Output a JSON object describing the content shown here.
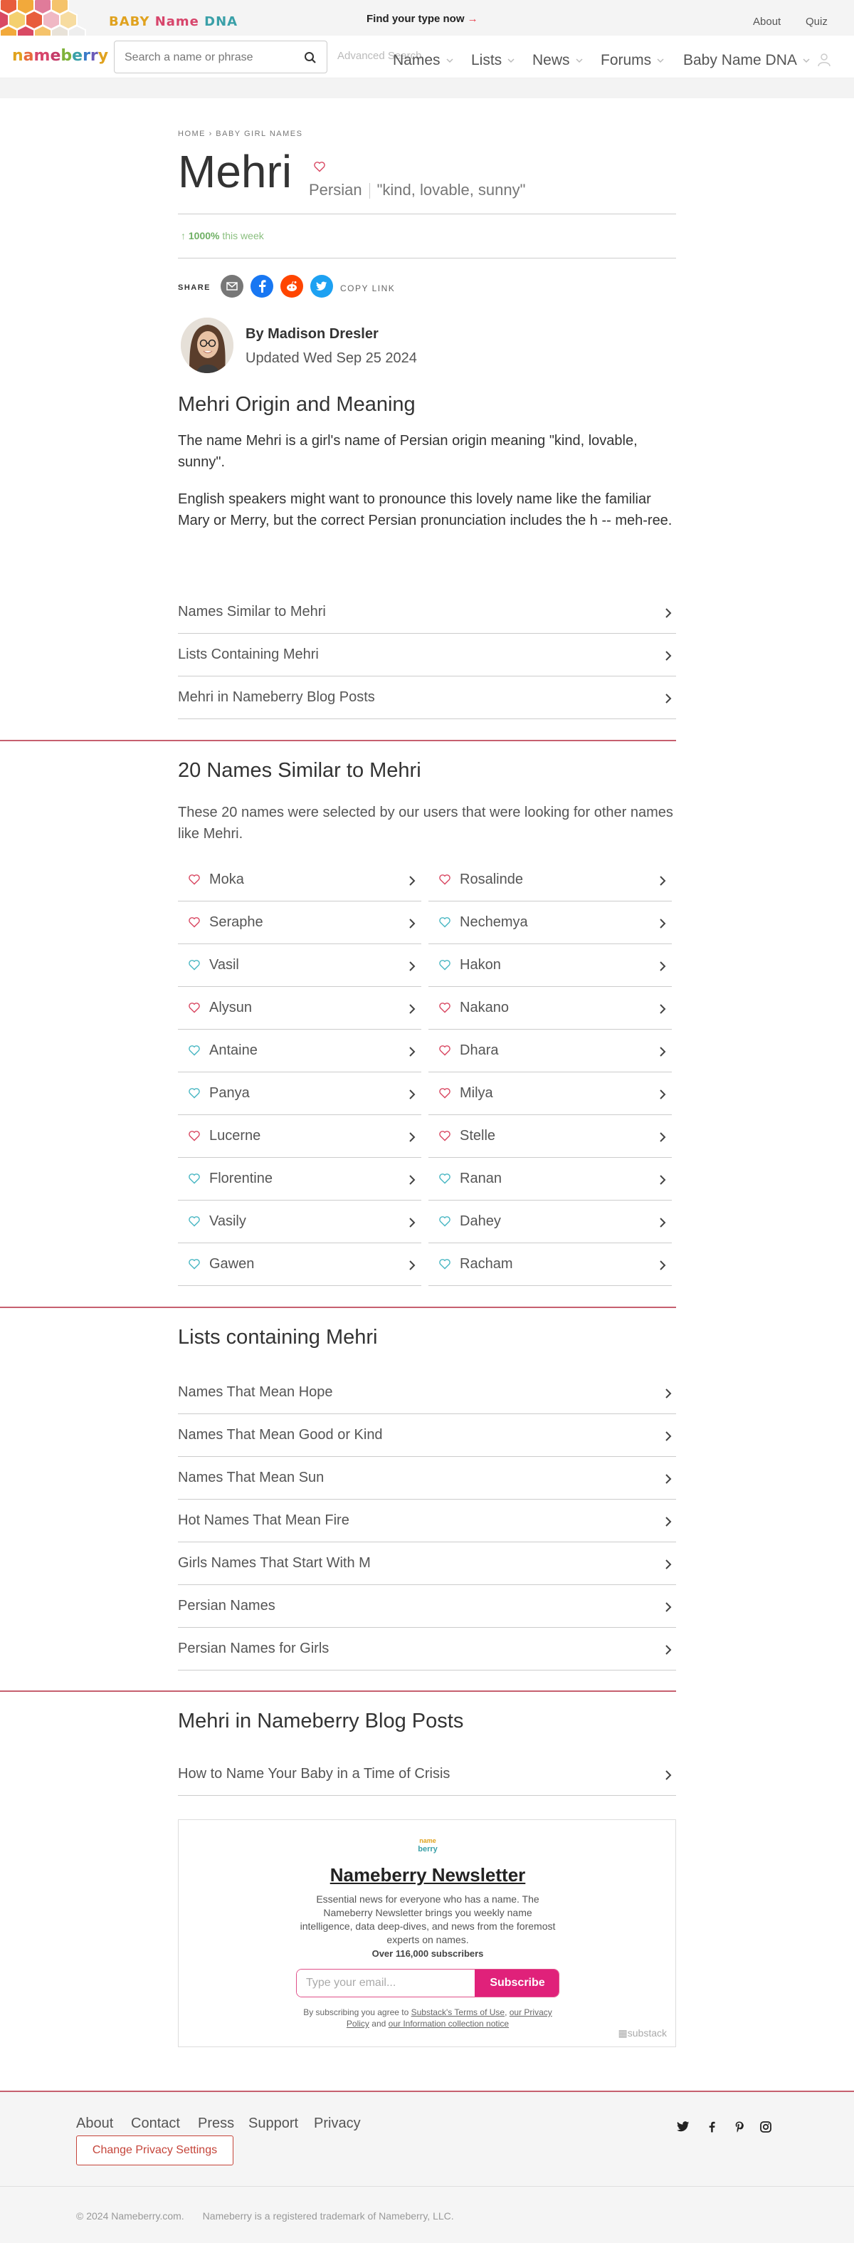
{
  "promo": {
    "logo_part1": "BABY ",
    "logo_part2": "Name ",
    "logo_part3": "DNA",
    "cta": "Find your type now",
    "cta_arrow": "→",
    "about": "About",
    "quiz": "Quiz"
  },
  "header": {
    "logo_letters": [
      "n",
      "a",
      "m",
      "e",
      "b",
      "e",
      "r",
      "r",
      "y"
    ],
    "logo_colors": [
      "#e0a21e",
      "#e86a3c",
      "#d7456b",
      "#c43b68",
      "#7fb23b",
      "#3aa0a8",
      "#3a7bc8",
      "#6b5bb8",
      "#e0a21e"
    ],
    "search_placeholder": "Search a name or phrase",
    "advanced_search": "Advanced Search",
    "nav": [
      "Names",
      "Lists",
      "News",
      "Forums",
      "Baby Name DNA"
    ]
  },
  "breadcrumb": {
    "home": "HOME",
    "sep": "›",
    "current": "BABY GIRL NAMES"
  },
  "name": {
    "title": "Mehri",
    "origin": "Persian",
    "meaning": "\"kind, lovable, sunny\""
  },
  "trend": {
    "arrow": "↑",
    "value": "1000%",
    "label": " this week"
  },
  "share": {
    "label": "SHARE",
    "copy": "COPY LINK"
  },
  "author": {
    "by": "By Madison Dresler",
    "updated": "Updated Wed Sep 25 2024"
  },
  "origin_section": {
    "heading": "Mehri Origin and Meaning",
    "p1": "The name Mehri is a girl's name of Persian origin meaning \"kind, lovable, sunny\".",
    "p2": "English speakers might want to pronounce this lovely name like the familiar Mary or Merry, but the correct Persian pronunciation includes the h -- meh-ree."
  },
  "quick_links": [
    "Names Similar to Mehri",
    "Lists Containing Mehri",
    "Mehri in Nameberry Blog Posts"
  ],
  "similar": {
    "heading": "20 Names Similar to Mehri",
    "subtitle": "These 20 names were selected by our users that were looking for other names like Mehri.",
    "left": [
      {
        "name": "Moka",
        "gender": "girl"
      },
      {
        "name": "Seraphe",
        "gender": "girl"
      },
      {
        "name": "Vasil",
        "gender": "boy"
      },
      {
        "name": "Alysun",
        "gender": "girl"
      },
      {
        "name": "Antaine",
        "gender": "boy"
      },
      {
        "name": "Panya",
        "gender": "boy"
      },
      {
        "name": "Lucerne",
        "gender": "girl"
      },
      {
        "name": "Florentine",
        "gender": "boy"
      },
      {
        "name": "Vasily",
        "gender": "boy"
      },
      {
        "name": "Gawen",
        "gender": "boy"
      }
    ],
    "right": [
      {
        "name": "Rosalinde",
        "gender": "girl"
      },
      {
        "name": "Nechemya",
        "gender": "boy"
      },
      {
        "name": "Hakon",
        "gender": "boy"
      },
      {
        "name": "Nakano",
        "gender": "girl"
      },
      {
        "name": "Dhara",
        "gender": "girl"
      },
      {
        "name": "Milya",
        "gender": "girl"
      },
      {
        "name": "Stelle",
        "gender": "girl"
      },
      {
        "name": "Ranan",
        "gender": "boy"
      },
      {
        "name": "Dahey",
        "gender": "boy"
      },
      {
        "name": "Racham",
        "gender": "boy"
      }
    ]
  },
  "lists": {
    "heading": "Lists containing Mehri",
    "items": [
      "Names That Mean Hope",
      "Names That Mean Good or Kind",
      "Names That Mean Sun",
      "Hot Names That Mean Fire",
      "Girls Names That Start With M",
      "Persian Names",
      "Persian Names for Girls"
    ]
  },
  "blog": {
    "heading": "Mehri in Nameberry Blog Posts",
    "items": [
      "How to Name Your Baby in a Time of Crisis"
    ]
  },
  "newsletter": {
    "logo_top": "name",
    "logo_bottom": "berry",
    "title": "Nameberry Newsletter",
    "description": "Essential news for everyone who has a name. The Nameberry Newsletter brings you weekly name intelligence, data deep-dives, and news from the foremost experts on names.",
    "subscribers": "Over 116,000 subscribers",
    "email_placeholder": "Type your email...",
    "subscribe": "Subscribe",
    "legal_1": "By subscribing you agree to ",
    "terms": "Substack's Terms of Use",
    "legal_2": ", ",
    "privacy": "our Privacy Policy",
    "legal_3": " and ",
    "info": "our Information collection notice",
    "substack": "substack"
  },
  "footer": {
    "links": [
      "About",
      "Contact",
      "Press",
      "Support",
      "Privacy"
    ],
    "privacy_button": "Change Privacy Settings",
    "copyright": "© 2024 Nameberry.com.",
    "trademark": "Nameberry is a registered trademark of Nameberry, LLC."
  },
  "colors": {
    "girl_heart": "#d94a64",
    "boy_heart": "#4cb8c4",
    "accent_line": "#c6606f",
    "subscribe": "#e0217a",
    "trend_green": "#6fb064"
  }
}
